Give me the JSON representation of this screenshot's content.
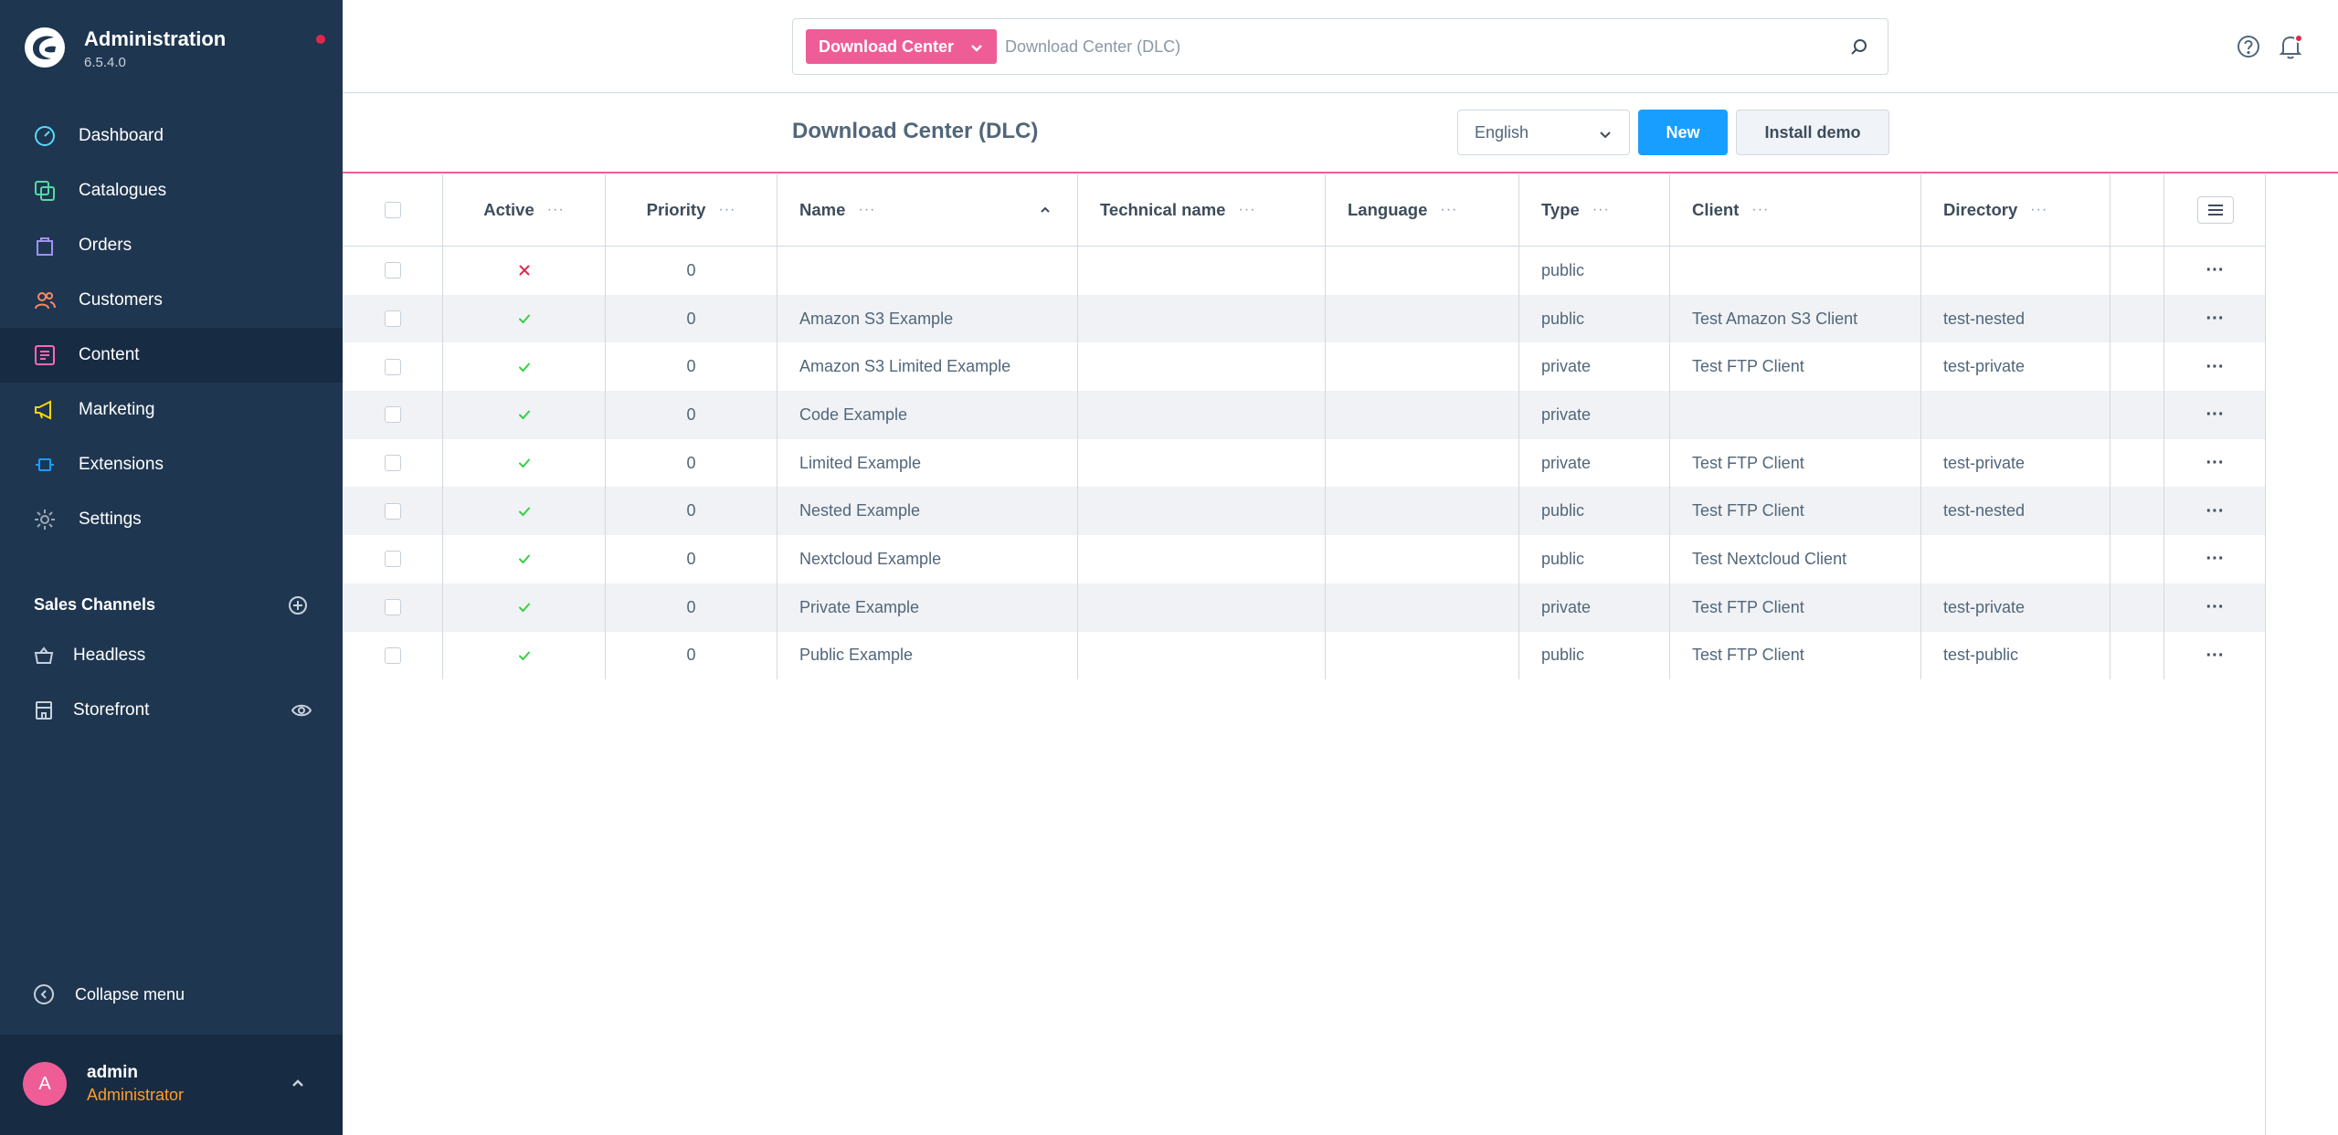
{
  "brand": {
    "title": "Administration",
    "version": "6.5.4.0"
  },
  "nav": [
    {
      "label": "Dashboard",
      "icon": "dashboard-icon",
      "color": "#57d9ff"
    },
    {
      "label": "Catalogues",
      "icon": "catalogues-icon",
      "color": "#57d9a3"
    },
    {
      "label": "Orders",
      "icon": "orders-icon",
      "color": "#a092f0"
    },
    {
      "label": "Customers",
      "icon": "customers-icon",
      "color": "#f88962"
    },
    {
      "label": "Content",
      "icon": "content-icon",
      "color": "#ff68b4"
    },
    {
      "label": "Marketing",
      "icon": "marketing-icon",
      "color": "#ffd700"
    },
    {
      "label": "Extensions",
      "icon": "extensions-icon",
      "color": "#189eff"
    },
    {
      "label": "Settings",
      "icon": "settings-icon",
      "color": "#9aa8b5"
    }
  ],
  "sales_channels": {
    "header": "Sales Channels",
    "items": [
      {
        "label": "Headless",
        "icon": "basket-icon"
      },
      {
        "label": "Storefront",
        "icon": "storefront-icon"
      }
    ]
  },
  "collapse_label": "Collapse menu",
  "user": {
    "initial": "A",
    "name": "admin",
    "role": "Administrator"
  },
  "search": {
    "module": "Download Center",
    "placeholder": "Download Center (DLC)"
  },
  "smartbar": {
    "title": "Download Center (DLC)",
    "language": "English",
    "new_label": "New",
    "demo_label": "Install demo"
  },
  "grid": {
    "columns": {
      "active": "Active",
      "priority": "Priority",
      "name": "Name",
      "technical_name": "Technical name",
      "language": "Language",
      "type": "Type",
      "client": "Client",
      "directory": "Directory"
    },
    "column_menu": "···",
    "row_menu": "···",
    "rows": [
      {
        "active": false,
        "priority": "0",
        "name": "",
        "technical_name": "",
        "language": "",
        "type": "public",
        "client": "",
        "directory": ""
      },
      {
        "active": true,
        "priority": "0",
        "name": "Amazon S3 Example",
        "technical_name": "",
        "language": "",
        "type": "public",
        "client": "Test Amazon S3 Client",
        "directory": "test-nested"
      },
      {
        "active": true,
        "priority": "0",
        "name": "Amazon S3 Limited Example",
        "technical_name": "",
        "language": "",
        "type": "private",
        "client": "Test FTP Client",
        "directory": "test-private"
      },
      {
        "active": true,
        "priority": "0",
        "name": "Code Example",
        "technical_name": "",
        "language": "",
        "type": "private",
        "client": "",
        "directory": ""
      },
      {
        "active": true,
        "priority": "0",
        "name": "Limited Example",
        "technical_name": "",
        "language": "",
        "type": "private",
        "client": "Test FTP Client",
        "directory": "test-private"
      },
      {
        "active": true,
        "priority": "0",
        "name": "Nested Example",
        "technical_name": "",
        "language": "",
        "type": "public",
        "client": "Test FTP Client",
        "directory": "test-nested"
      },
      {
        "active": true,
        "priority": "0",
        "name": "Nextcloud Example",
        "technical_name": "",
        "language": "",
        "type": "public",
        "client": "Test Nextcloud Client",
        "directory": ""
      },
      {
        "active": true,
        "priority": "0",
        "name": "Private Example",
        "technical_name": "",
        "language": "",
        "type": "private",
        "client": "Test FTP Client",
        "directory": "test-private"
      },
      {
        "active": true,
        "priority": "0",
        "name": "Public Example",
        "technical_name": "",
        "language": "",
        "type": "public",
        "client": "Test FTP Client",
        "directory": "test-public"
      }
    ]
  },
  "colors": {
    "sidebar": "#1f3650",
    "sidebar_active": "#172b43",
    "accent_pink": "#ef5d97",
    "primary": "#189eff",
    "success": "#37d046",
    "danger": "#de294c",
    "role": "#ff9d2c"
  }
}
